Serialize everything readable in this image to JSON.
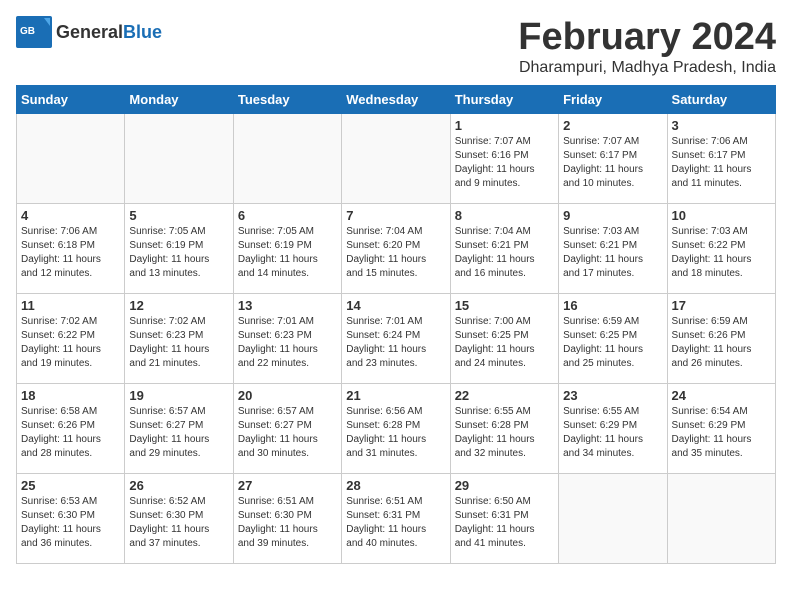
{
  "header": {
    "logo_general": "General",
    "logo_blue": "Blue",
    "month": "February 2024",
    "location": "Dharampuri, Madhya Pradesh, India"
  },
  "weekdays": [
    "Sunday",
    "Monday",
    "Tuesday",
    "Wednesday",
    "Thursday",
    "Friday",
    "Saturday"
  ],
  "weeks": [
    [
      {
        "day": "",
        "info": ""
      },
      {
        "day": "",
        "info": ""
      },
      {
        "day": "",
        "info": ""
      },
      {
        "day": "",
        "info": ""
      },
      {
        "day": "1",
        "info": "Sunrise: 7:07 AM\nSunset: 6:16 PM\nDaylight: 11 hours\nand 9 minutes."
      },
      {
        "day": "2",
        "info": "Sunrise: 7:07 AM\nSunset: 6:17 PM\nDaylight: 11 hours\nand 10 minutes."
      },
      {
        "day": "3",
        "info": "Sunrise: 7:06 AM\nSunset: 6:17 PM\nDaylight: 11 hours\nand 11 minutes."
      }
    ],
    [
      {
        "day": "4",
        "info": "Sunrise: 7:06 AM\nSunset: 6:18 PM\nDaylight: 11 hours\nand 12 minutes."
      },
      {
        "day": "5",
        "info": "Sunrise: 7:05 AM\nSunset: 6:19 PM\nDaylight: 11 hours\nand 13 minutes."
      },
      {
        "day": "6",
        "info": "Sunrise: 7:05 AM\nSunset: 6:19 PM\nDaylight: 11 hours\nand 14 minutes."
      },
      {
        "day": "7",
        "info": "Sunrise: 7:04 AM\nSunset: 6:20 PM\nDaylight: 11 hours\nand 15 minutes."
      },
      {
        "day": "8",
        "info": "Sunrise: 7:04 AM\nSunset: 6:21 PM\nDaylight: 11 hours\nand 16 minutes."
      },
      {
        "day": "9",
        "info": "Sunrise: 7:03 AM\nSunset: 6:21 PM\nDaylight: 11 hours\nand 17 minutes."
      },
      {
        "day": "10",
        "info": "Sunrise: 7:03 AM\nSunset: 6:22 PM\nDaylight: 11 hours\nand 18 minutes."
      }
    ],
    [
      {
        "day": "11",
        "info": "Sunrise: 7:02 AM\nSunset: 6:22 PM\nDaylight: 11 hours\nand 19 minutes."
      },
      {
        "day": "12",
        "info": "Sunrise: 7:02 AM\nSunset: 6:23 PM\nDaylight: 11 hours\nand 21 minutes."
      },
      {
        "day": "13",
        "info": "Sunrise: 7:01 AM\nSunset: 6:23 PM\nDaylight: 11 hours\nand 22 minutes."
      },
      {
        "day": "14",
        "info": "Sunrise: 7:01 AM\nSunset: 6:24 PM\nDaylight: 11 hours\nand 23 minutes."
      },
      {
        "day": "15",
        "info": "Sunrise: 7:00 AM\nSunset: 6:25 PM\nDaylight: 11 hours\nand 24 minutes."
      },
      {
        "day": "16",
        "info": "Sunrise: 6:59 AM\nSunset: 6:25 PM\nDaylight: 11 hours\nand 25 minutes."
      },
      {
        "day": "17",
        "info": "Sunrise: 6:59 AM\nSunset: 6:26 PM\nDaylight: 11 hours\nand 26 minutes."
      }
    ],
    [
      {
        "day": "18",
        "info": "Sunrise: 6:58 AM\nSunset: 6:26 PM\nDaylight: 11 hours\nand 28 minutes."
      },
      {
        "day": "19",
        "info": "Sunrise: 6:57 AM\nSunset: 6:27 PM\nDaylight: 11 hours\nand 29 minutes."
      },
      {
        "day": "20",
        "info": "Sunrise: 6:57 AM\nSunset: 6:27 PM\nDaylight: 11 hours\nand 30 minutes."
      },
      {
        "day": "21",
        "info": "Sunrise: 6:56 AM\nSunset: 6:28 PM\nDaylight: 11 hours\nand 31 minutes."
      },
      {
        "day": "22",
        "info": "Sunrise: 6:55 AM\nSunset: 6:28 PM\nDaylight: 11 hours\nand 32 minutes."
      },
      {
        "day": "23",
        "info": "Sunrise: 6:55 AM\nSunset: 6:29 PM\nDaylight: 11 hours\nand 34 minutes."
      },
      {
        "day": "24",
        "info": "Sunrise: 6:54 AM\nSunset: 6:29 PM\nDaylight: 11 hours\nand 35 minutes."
      }
    ],
    [
      {
        "day": "25",
        "info": "Sunrise: 6:53 AM\nSunset: 6:30 PM\nDaylight: 11 hours\nand 36 minutes."
      },
      {
        "day": "26",
        "info": "Sunrise: 6:52 AM\nSunset: 6:30 PM\nDaylight: 11 hours\nand 37 minutes."
      },
      {
        "day": "27",
        "info": "Sunrise: 6:51 AM\nSunset: 6:30 PM\nDaylight: 11 hours\nand 39 minutes."
      },
      {
        "day": "28",
        "info": "Sunrise: 6:51 AM\nSunset: 6:31 PM\nDaylight: 11 hours\nand 40 minutes."
      },
      {
        "day": "29",
        "info": "Sunrise: 6:50 AM\nSunset: 6:31 PM\nDaylight: 11 hours\nand 41 minutes."
      },
      {
        "day": "",
        "info": ""
      },
      {
        "day": "",
        "info": ""
      }
    ]
  ]
}
